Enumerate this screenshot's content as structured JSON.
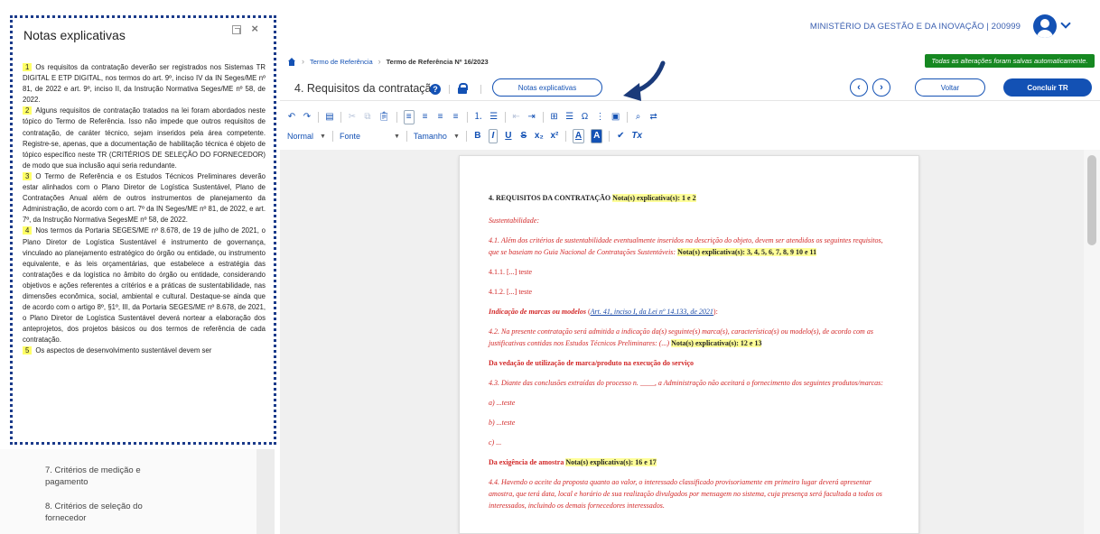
{
  "header": {
    "org": "MINISTÉRIO DA GESTÃO E DA INOVAÇÃO | 200999"
  },
  "breadcrumb": {
    "items": [
      "Termo de Referência",
      "Termo de Referência Nº 16/2023"
    ]
  },
  "status": {
    "saved": "Todas as alterações foram salvas automaticamente."
  },
  "section": {
    "title": "4. Requisitos da contratação",
    "help": "?",
    "notes_button": "Notas explicativas",
    "prev": "‹",
    "next": "›",
    "back_button": "Voltar",
    "finish_button": "Concluir TR"
  },
  "toolbar": {
    "format_label": "Normal",
    "font_label": "Fonte",
    "size_label": "Tamanho",
    "btn_bold": "B",
    "btn_italic": "I",
    "btn_underline": "U",
    "btn_strike": "S",
    "btn_sub": "x₂",
    "btn_sup": "x²",
    "btn_textcolor": "A",
    "btn_bgcolor": "A",
    "btn_clear": "Tx"
  },
  "document": {
    "heading": "4. REQUISITOS DA CONTRATAÇÃO",
    "heading_note": "Nota(s) explicativa(s): 1 e 2",
    "sust_title": "Sustentabilidade:",
    "p41": "4.1. Além dos critérios de sustentabilidade eventualmente inseridos na descrição do objeto, devem ser atendidos os seguintes requisitos, que se baseiam no Guia Nacional de Contratações Sustentáveis:",
    "p41_note": "Nota(s) explicativa(s): 3, 4, 5, 6, 7, 8, 9 10 e 11",
    "p411": "4.1.1. [...] teste",
    "p412": "4.1.2. [...] teste",
    "marcas_title": "Indicação de marcas ou modelos",
    "marcas_link": "Art. 41, inciso I, da Lei nº 14.133, de 2021",
    "p42": "4.2. Na presente contratação será admitida a indicação da(s) seguinte(s) marca(s), característica(s) ou modelo(s), de acordo com as justificativas contidas nos Estudos Técnicos Preliminares: (...)",
    "p42_note": "Nota(s) explicativa(s): 12 e 13",
    "vedacao_title": "Da vedação de utilização de marca/produto na execução do serviço",
    "p43": "4.3. Diante das conclusões extraídas do processo n. ____, a Administração não aceitará o fornecimento dos seguintes produtos/marcas:",
    "item_a": "a) ...teste",
    "item_b": "b) ...teste",
    "item_c": "c) ...",
    "amostra_title": "Da exigência de amostra",
    "amostra_note": "Nota(s) explicativa(s): 16 e 17",
    "p44": "4.4. Havendo o aceite da proposta quanto ao valor, o interessado classificado provisoriamente em primeiro lugar deverá apresentar amostra, que terá data, local e horário de sua realização divulgados por mensagem no sistema, cuja presença será facultada a todos os interessados, incluindo os demais fornecedores interessados."
  },
  "nav": {
    "item7": "7.  Critérios de medição e pagamento",
    "item8": "8.  Critérios de seleção do fornecedor"
  },
  "notes_panel": {
    "title": "Notas explicativas",
    "close": "×",
    "notes": [
      {
        "num": "1",
        "text": "Os requisitos da contratação deverão ser registrados nos Sistemas TR DIGITAL E ETP DIGITAL, nos termos do art. 9º, inciso IV da IN Seges/ME nº 81, de 2022 e art. 9º, inciso II, da Instrução Normativa Seges/ME nº 58, de 2022."
      },
      {
        "num": "2",
        "text": "Alguns requisitos de contratação tratados na lei foram abordados neste tópico do Termo de Referência. Isso não impede que outros requisitos de contratação, de caráter técnico, sejam inseridos pela área competente. Registre-se, apenas, que a documentação de habilitação técnica é objeto de tópico específico neste TR (CRITÉRIOS DE SELEÇÃO DO FORNECEDOR) de modo que sua inclusão aqui seria redundante."
      },
      {
        "num": "3",
        "text": "O Termo de Referência e os Estudos Técnicos Preliminares deverão estar alinhados com o Plano Diretor de Logística Sustentável, Plano de Contratações Anual além de outros instrumentos de planejamento da Administração, de acordo com o art. 7º da IN Seges/ME nº 81, de 2022, e art. 7º, da Instrução Normativa SegesME nº 58, de 2022."
      },
      {
        "num": "4",
        "text": "Nos termos da Portaria SEGES/ME nº 8.678, de 19 de julho de 2021, o Plano Diretor de Logística Sustentável é instrumento de governança, vinculado ao planejamento estratégico do órgão ou entidade, ou instrumento equivalente, e às leis orçamentárias, que estabelece a estratégia das contratações e da logística no âmbito do órgão ou entidade, considerando objetivos e ações referentes a critérios e a práticas de sustentabilidade, nas dimensões econômica, social, ambiental e cultural. Destaque-se ainda que de acordo com o artigo 8º, §1º, III, da Portaria SEGES/ME nº 8.678, de 2021, o Plano Diretor de Logística Sustentável deverá nortear a elaboração dos anteprojetos, dos projetos básicos ou dos termos de referência de cada contratação."
      },
      {
        "num": "5",
        "text": "Os aspectos de desenvolvimento sustentável devem ser"
      }
    ]
  }
}
